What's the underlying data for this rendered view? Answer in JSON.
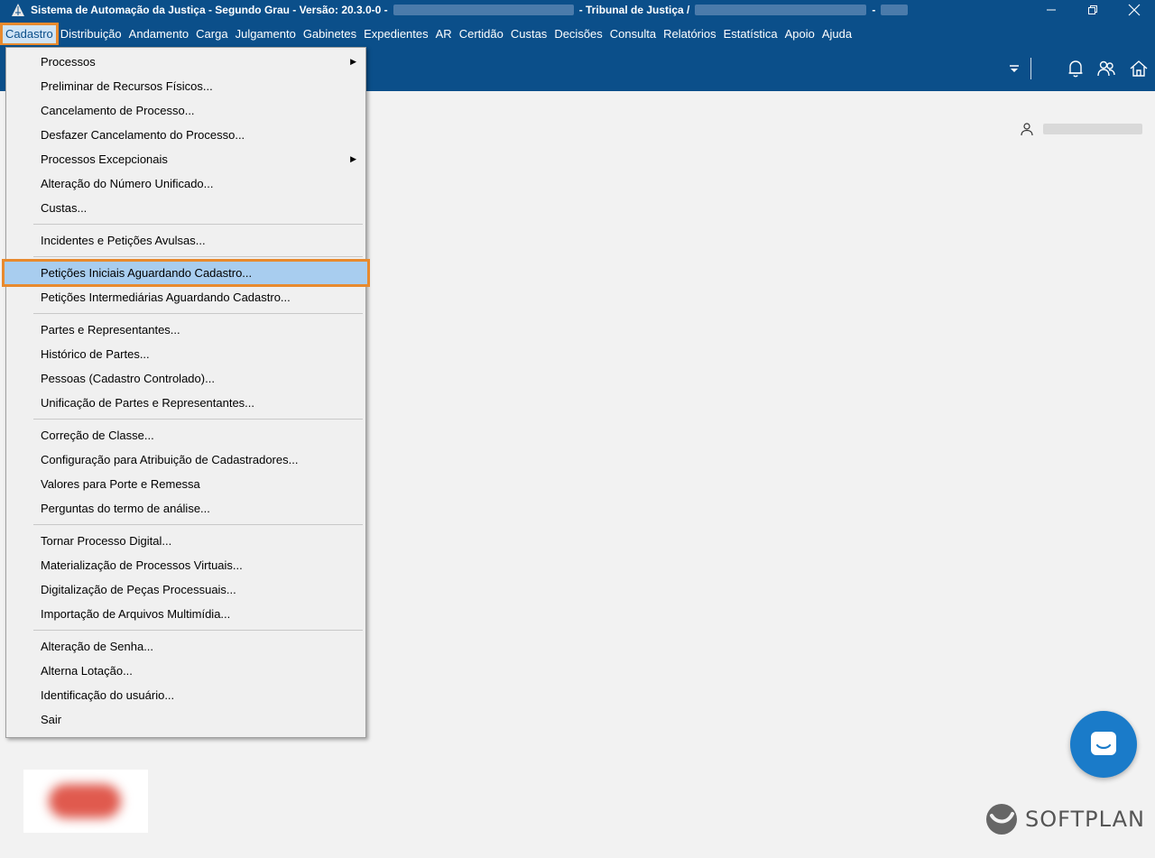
{
  "window": {
    "title_part1": "Sistema de Automação da Justiça - Segundo Grau - Versão: 20.3.0-0 -",
    "title_part2": "- Tribunal de Justiça /",
    "title_part3": "-"
  },
  "menubar": {
    "items": [
      "Cadastro",
      "Distribuição",
      "Andamento",
      "Carga",
      "Julgamento",
      "Gabinetes",
      "Expedientes",
      "AR",
      "Certidão",
      "Custas",
      "Decisões",
      "Consulta",
      "Relatórios",
      "Estatística",
      "Apoio",
      "Ajuda"
    ],
    "active": "Cadastro"
  },
  "dropdown": {
    "items": [
      {
        "label": "Processos",
        "submenu": true
      },
      {
        "label": "Preliminar de Recursos Físicos..."
      },
      {
        "label": "Cancelamento de Processo..."
      },
      {
        "label": "Desfazer Cancelamento do Processo..."
      },
      {
        "label": "Processos Excepcionais",
        "submenu": true
      },
      {
        "label": "Alteração do Número Unificado..."
      },
      {
        "label": "Custas..."
      },
      {
        "separator": true
      },
      {
        "label": "Incidentes e Petições Avulsas..."
      },
      {
        "separator": true
      },
      {
        "label": "Petições Iniciais Aguardando Cadastro...",
        "highlighted": true
      },
      {
        "label": "Petições Intermediárias Aguardando Cadastro..."
      },
      {
        "separator": true
      },
      {
        "label": "Partes e Representantes..."
      },
      {
        "label": "Histórico de Partes..."
      },
      {
        "label": "Pessoas (Cadastro Controlado)..."
      },
      {
        "label": "Unificação de Partes e Representantes..."
      },
      {
        "separator": true
      },
      {
        "label": "Correção de Classe..."
      },
      {
        "label": "Configuração para Atribuição de Cadastradores..."
      },
      {
        "label": "Valores para Porte e Remessa"
      },
      {
        "label": "Perguntas do termo de análise..."
      },
      {
        "separator": true
      },
      {
        "label": "Tornar Processo Digital..."
      },
      {
        "label": "Materialização de Processos Virtuais..."
      },
      {
        "label": "Digitalização de Peças Processuais..."
      },
      {
        "label": "Importação de Arquivos Multimídia..."
      },
      {
        "separator": true
      },
      {
        "label": "Alteração de Senha..."
      },
      {
        "label": "Alterna Lotação..."
      },
      {
        "label": "Identificação do usuário..."
      },
      {
        "label": "Sair"
      }
    ]
  },
  "footer": {
    "brand": "SOFTPLAN"
  },
  "colors": {
    "header": "#0b4f8a",
    "highlight": "#a8cdef",
    "callout": "#e88a2e",
    "chat": "#1a7bc9"
  }
}
